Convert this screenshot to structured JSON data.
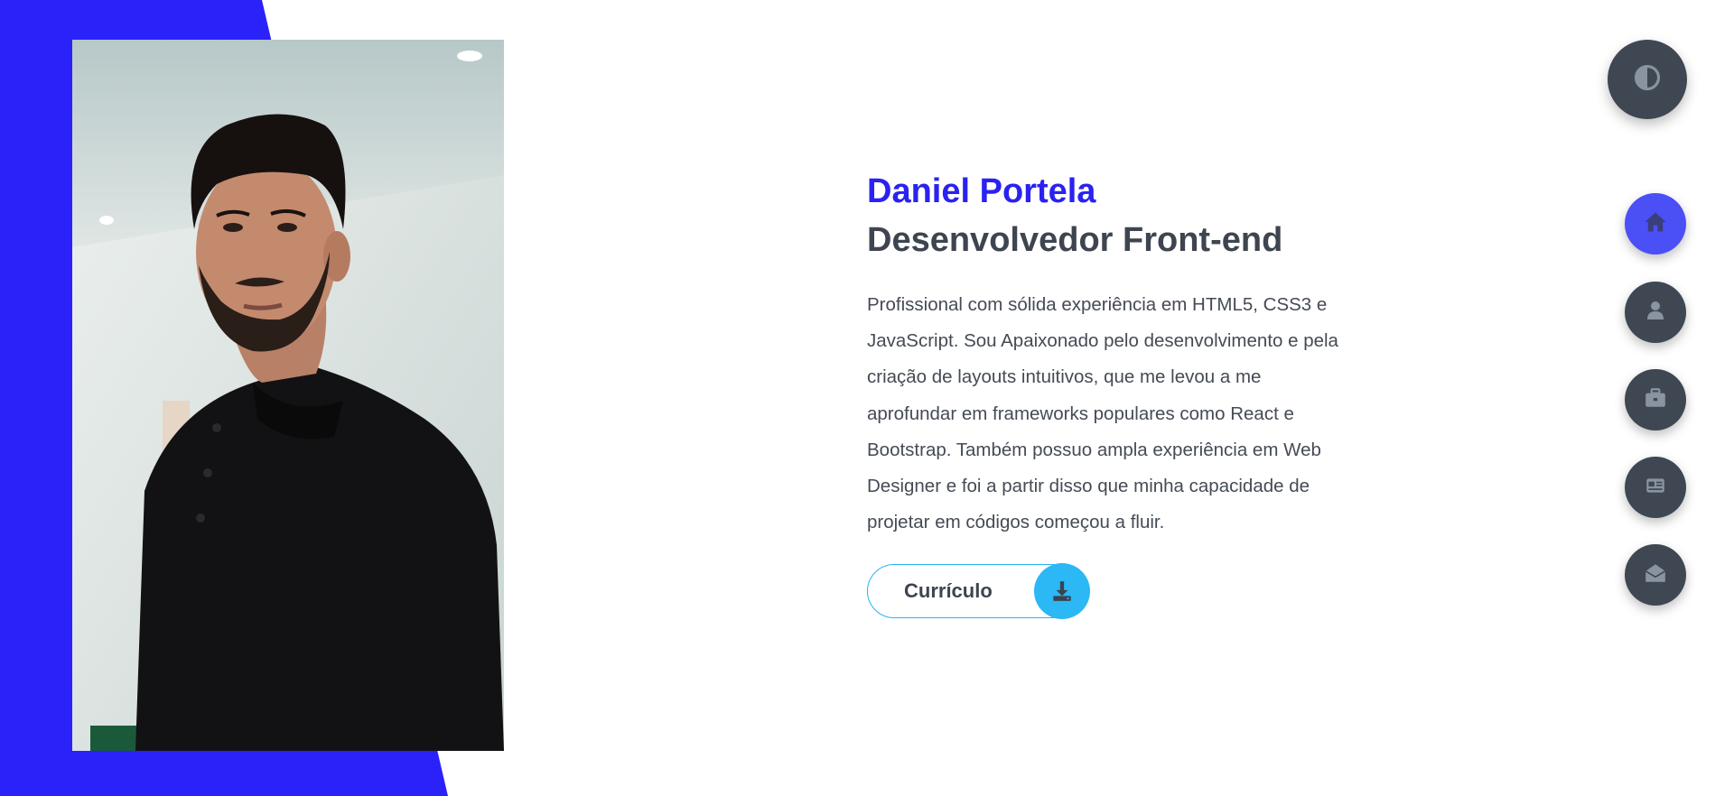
{
  "hero": {
    "name": "Daniel Portela",
    "role": "Desenvolvedor Front-end",
    "bio_lines": [
      "Profissional com sólida experiência em HTML5, CSS3 e",
      "JavaScript. Sou Apaixonado pelo desenvolvimento e pela",
      "criação de layouts intuitivos, que me levou a me",
      "aprofundar em frameworks populares como React e",
      "Bootstrap. Também possuo ampla experiência em Web",
      "Designer e foi a partir disso que minha capacidade de",
      "projetar em códigos começou a fluir."
    ],
    "cv_button_label": "Currículo",
    "cv_button_icon": "download-icon"
  },
  "theme_toggle": {
    "icon": "contrast-icon"
  },
  "nav": {
    "items": [
      {
        "icon": "home-icon",
        "active": true
      },
      {
        "icon": "user-icon",
        "active": false
      },
      {
        "icon": "briefcase-icon",
        "active": false
      },
      {
        "icon": "newspaper-icon",
        "active": false
      },
      {
        "icon": "envelope-open-icon",
        "active": false
      }
    ]
  },
  "colors": {
    "accent_blue": "#2a22f0",
    "active_nav": "#4a4ff6",
    "dark_button": "#3f4753",
    "cv_accent": "#2bb8f4",
    "heading_dark": "#3e4550",
    "body_text": "#454b55"
  }
}
